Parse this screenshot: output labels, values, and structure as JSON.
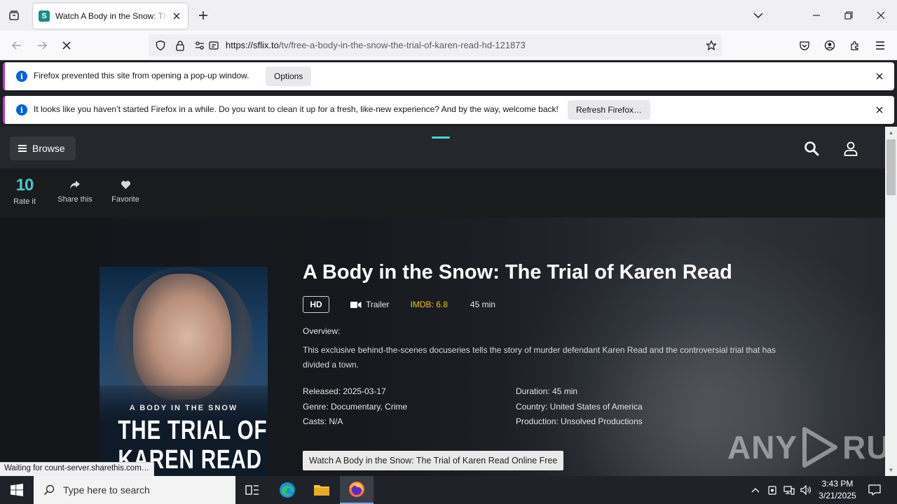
{
  "browser": {
    "tab_title": "Watch A Body in the Snow: The Trial of Karen Read",
    "url_host": "https://sflix.to",
    "url_path": "/tv/free-a-body-in-the-snow-the-trial-of-karen-read-hd-121873"
  },
  "notices": [
    {
      "text": "Firefox prevented this site from opening a pop-up window.",
      "button": "Options"
    },
    {
      "text": "It looks like you haven’t started Firefox in a while. Do you want to clean it up for a fresh, like-new experience? And by the way, welcome back!",
      "button": "Refresh Firefox…"
    }
  ],
  "site": {
    "browse_label": "Browse",
    "actions": {
      "rating_value": "10",
      "rate_label": "Rate it",
      "share_label": "Share this",
      "favorite_label": "Favorite"
    }
  },
  "poster": {
    "subtitle": "A BODY IN THE SNOW",
    "title_line1": "THE TRIAL OF",
    "title_line2": "KAREN READ"
  },
  "movie": {
    "title": "A Body in the Snow: The Trial of Karen Read",
    "quality": "HD",
    "trailer_label": "Trailer",
    "imdb": "IMDB: 6.8",
    "duration_short": "45 min",
    "overview_label": "Overview:",
    "overview": "This exclusive behind-the-scenes docuseries tells the story of murder defendant Karen Read and the controversial trial that has divided a town.",
    "released": "Released: 2025-03-17",
    "genre": "Genre: Documentary, Crime",
    "casts": "Casts: N/A",
    "duration": "Duration: 45 min",
    "country": "Country: United States of America",
    "production": "Production: Unsolved Productions",
    "watch_button": "Watch A Body in the Snow: The Trial of Karen Read Online Free"
  },
  "watermark": {
    "left": "ANY",
    "right": "RUN"
  },
  "status_text": "Waiting for count-server.sharethis.com…",
  "taskbar": {
    "search_placeholder": "Type here to search",
    "time": "3:43 PM",
    "date": "3/21/2025"
  },
  "colors": {
    "accent_teal": "#4ac7d0",
    "imdb_yellow": "#f5c518",
    "notice_bar": "#b833e1",
    "info_blue": "#0061e0"
  }
}
